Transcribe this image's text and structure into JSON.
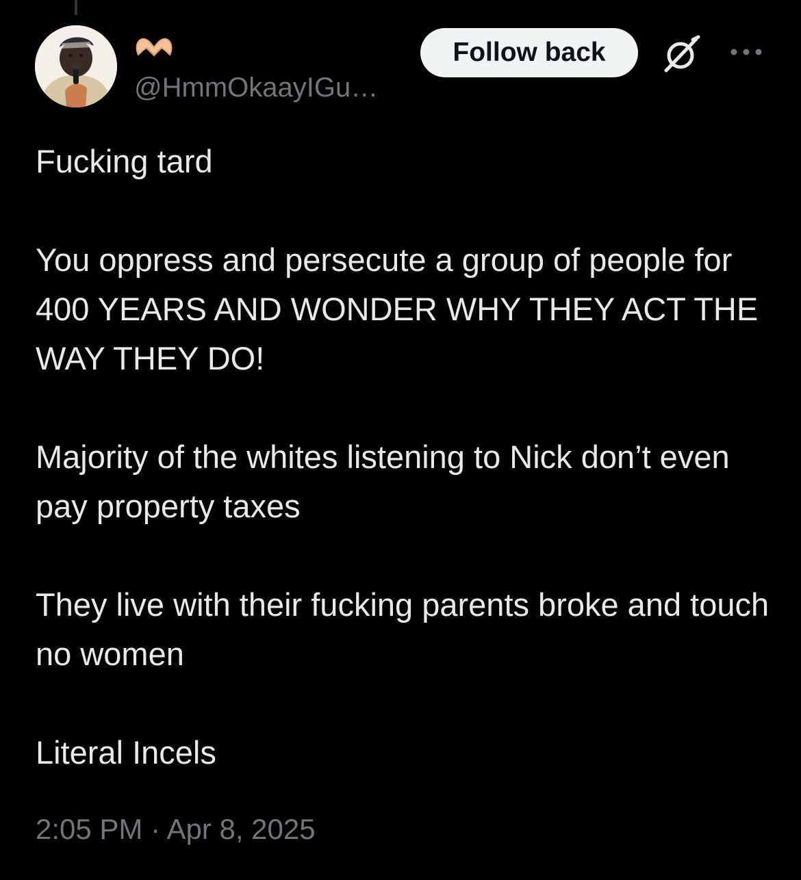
{
  "author": {
    "name_emoji": "🫶",
    "handle": "@HmmOkaayIGu…"
  },
  "actions": {
    "follow_label": "Follow back",
    "grok_icon": "grok-icon",
    "more_icon": "more-horizontal-icon"
  },
  "tweet": {
    "paragraphs": [
      "Fucking tard",
      "You oppress and persecute a group of people for 400 YEARS AND WONDER WHY THEY ACT THE WAY THEY DO!",
      "Majority of the whites listening to Nick don’t even pay property taxes",
      "They live with their fucking parents broke and touch no women",
      "Literal Incels"
    ]
  },
  "meta": {
    "time": "2:05 PM",
    "separator": " · ",
    "date": "Apr 8, 2025"
  },
  "colors": {
    "background": "#000000",
    "text_primary": "#e7e9ea",
    "text_secondary": "#71767b",
    "button_bg": "#eff3f4",
    "button_text": "#0f1419",
    "emoji_fill": "#f2c29b"
  }
}
